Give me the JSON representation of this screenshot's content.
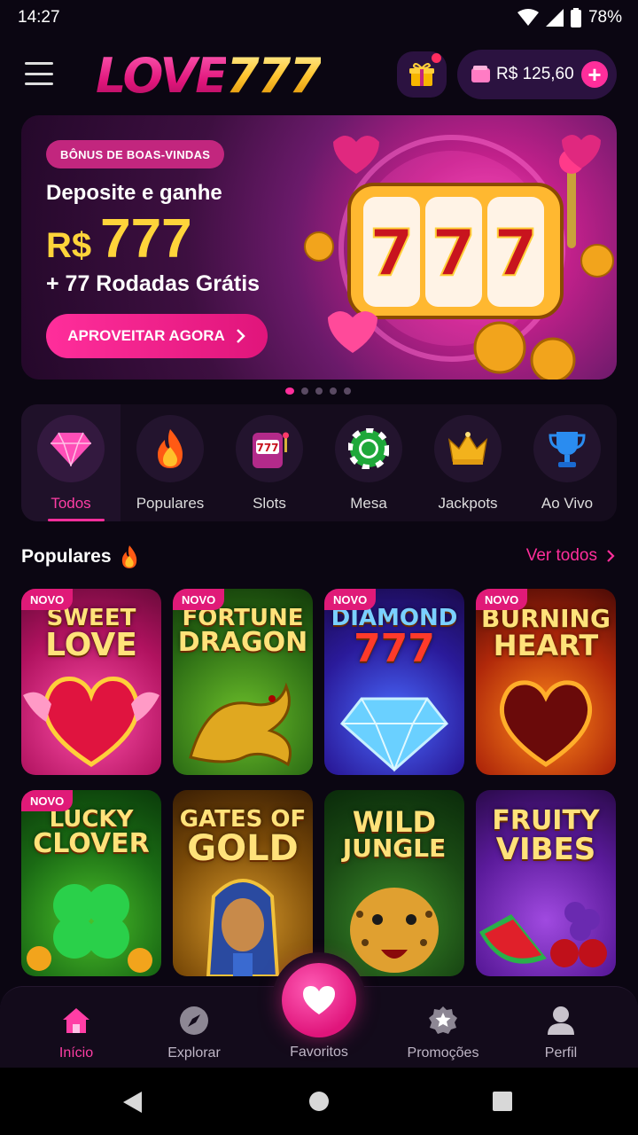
{
  "status_bar": {
    "time": "14:27",
    "battery": "78%"
  },
  "header": {
    "logo_love": "LOVE",
    "logo_number": "777",
    "balance": "R$ 125,60",
    "plus_symbol": "+"
  },
  "banner": {
    "badge": "BÔNUS DE BOAS-VINDAS",
    "line1": "Deposite e ganhe",
    "currency": "R$",
    "amount": "777",
    "line3": "+ 77 Rodadas Grátis",
    "cta": "APROVEITAR AGORA",
    "art_reel_digits": [
      "7",
      "7",
      "7"
    ],
    "slide_count": 5,
    "active_slide": 1
  },
  "categories": [
    {
      "label": "Todos",
      "icon": "diamond-icon",
      "active": true
    },
    {
      "label": "Populares",
      "icon": "fire-icon",
      "active": false
    },
    {
      "label": "Slots",
      "icon": "slot-machine-icon",
      "active": false
    },
    {
      "label": "Mesa",
      "icon": "poker-chip-icon",
      "active": false
    },
    {
      "label": "Jackpots",
      "icon": "crown-icon",
      "active": false
    },
    {
      "label": "Ao Vivo",
      "icon": "trophy-icon",
      "active": false
    }
  ],
  "section": {
    "title": "Populares",
    "see_all": "Ver todos"
  },
  "games": [
    {
      "line1": "SWEET",
      "line2": "LOVE",
      "new": true,
      "new_label": "NOVO",
      "bg": "#c0206e"
    },
    {
      "line1": "FORTUNE",
      "line2": "DRAGON",
      "new": true,
      "new_label": "NOVO",
      "bg": "#2d6a1a"
    },
    {
      "line1": "DIAMOND",
      "line2": "777",
      "new": true,
      "new_label": "NOVO",
      "bg": "#3a1a8a"
    },
    {
      "line1": "BURNING",
      "line2": "HEART",
      "new": true,
      "new_label": "NOVO",
      "bg": "#8a1a10"
    },
    {
      "line1": "LUCKY",
      "line2": "CLOVER",
      "new": true,
      "new_label": "NOVO",
      "bg": "#1f6a1a"
    },
    {
      "line1": "GATES OF",
      "line2": "GOLD",
      "new": false,
      "new_label": "",
      "bg": "#6a4008"
    },
    {
      "line1": "WILD",
      "line2": "JUNGLE",
      "new": false,
      "new_label": "",
      "bg": "#1a4a20"
    },
    {
      "line1": "FRUITY",
      "line2": "VIBES",
      "new": false,
      "new_label": "",
      "bg": "#4a1a7a"
    }
  ],
  "bottom_nav": [
    {
      "label": "Início",
      "icon": "home-icon",
      "active": true
    },
    {
      "label": "Explorar",
      "icon": "compass-icon",
      "active": false
    },
    {
      "label": "Favoritos",
      "icon": "heart-icon",
      "active": false
    },
    {
      "label": "Promoções",
      "icon": "star-badge-icon",
      "active": false
    },
    {
      "label": "Perfil",
      "icon": "user-icon",
      "active": false
    }
  ],
  "colors": {
    "accent": "#ff2e9b",
    "gold": "#ffd43a",
    "background": "#0b0612"
  }
}
